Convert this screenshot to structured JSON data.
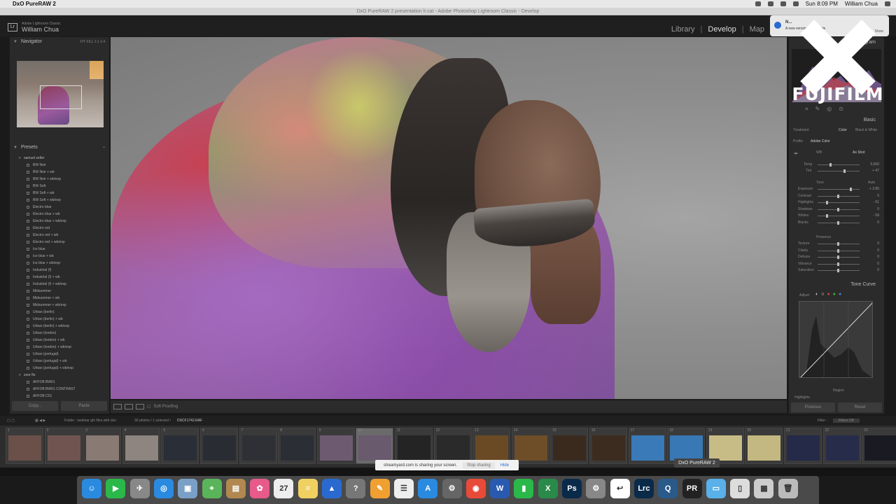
{
  "menubar": {
    "app": "DxO PureRAW 2",
    "time": "Sun 8:09 PM",
    "user": "William Chua"
  },
  "window_title": "DxO PureRAW 2 presentation lr.cat - Adobe Photoshop Lightroom Classic - Develop",
  "lr": {
    "catalog_label": "Adobe Lightroom Classic",
    "user": "William Chua",
    "modules": [
      "Library",
      "Develop",
      "Map"
    ],
    "active_module": "Develop"
  },
  "notification": {
    "title": "N...",
    "body": "A new version is available",
    "action": "Show"
  },
  "fuji_logo": "FUJIFILM",
  "left": {
    "navigator": "Navigator",
    "navigator_zoom": "FIT  FILL  1:1  1:4",
    "presets_title": "Presets",
    "presets": [
      {
        "label": "samuel zeller",
        "group": true
      },
      {
        "label": "BW Noir"
      },
      {
        "label": "BW Noir + wb"
      },
      {
        "label": "BW Noir + wb/exp"
      },
      {
        "label": "BW Soft"
      },
      {
        "label": "BW Soft + wb"
      },
      {
        "label": "BW Soft + wb/exp"
      },
      {
        "label": "Electro blue"
      },
      {
        "label": "Electro blue + wb"
      },
      {
        "label": "Electro blue + wb/exp"
      },
      {
        "label": "Electro red"
      },
      {
        "label": "Electro red + wb"
      },
      {
        "label": "Electro red + wb/exp"
      },
      {
        "label": "Ice blue"
      },
      {
        "label": "Ice blue + wb"
      },
      {
        "label": "Ice blue + wb/exp"
      },
      {
        "label": "Industrial (f)"
      },
      {
        "label": "Industrial (f) + wb"
      },
      {
        "label": "Industrial (f) + wb/exp"
      },
      {
        "label": "Midsummer"
      },
      {
        "label": "Midsummer + wb"
      },
      {
        "label": "Midsummer + wb/exp"
      },
      {
        "label": "Urban (berlin)"
      },
      {
        "label": "Urban (berlin) + wb"
      },
      {
        "label": "Urban (berlin) + wb/exp"
      },
      {
        "label": "Urban (london)"
      },
      {
        "label": "Urban (london) + wb"
      },
      {
        "label": "Urban (london) + wb/exp"
      },
      {
        "label": "Urban (portugal)"
      },
      {
        "label": "Urban (portugal) + wb"
      },
      {
        "label": "Urban (portugal) + wb/exp"
      },
      {
        "label": "zoor flo",
        "group": true
      },
      {
        "label": "AFFOB BW01"
      },
      {
        "label": "AFFOB BW01 CONTRAST"
      },
      {
        "label": "AFFOB C01"
      }
    ],
    "copy": "Copy...",
    "paste": "Paste"
  },
  "toolbar": {
    "soft_proofing": "Soft Proofing"
  },
  "right": {
    "histogram": "Histogram",
    "basic": "Basic",
    "treatment": "Treatment",
    "color": "Color",
    "bw": "Black & White",
    "profile": "Profile",
    "profile_value": "Adobe Color",
    "wb": "WB",
    "wb_value": "As Shot",
    "temp": "Temp",
    "temp_value": "5,000",
    "tint": "Tint",
    "tint_value": "+ 47",
    "tone": "Tone",
    "auto": "Auto",
    "sliders": [
      {
        "label": "Exposure",
        "value": "+ 2.85"
      },
      {
        "label": "Contrast",
        "value": "0"
      },
      {
        "label": "Highlights",
        "value": "- 61"
      },
      {
        "label": "Shadows",
        "value": "0"
      },
      {
        "label": "Whites",
        "value": "- 59"
      },
      {
        "label": "Blacks",
        "value": "0"
      }
    ],
    "presence": "Presence",
    "presence_sliders": [
      {
        "label": "Texture",
        "value": "0"
      },
      {
        "label": "Clarity",
        "value": "0"
      },
      {
        "label": "Dehaze",
        "value": "0"
      },
      {
        "label": "Vibrance",
        "value": "0"
      },
      {
        "label": "Saturation",
        "value": "0"
      }
    ],
    "tone_curve": "Tone Curve",
    "adjust": "Adjust",
    "region": "Region",
    "highlights": "Highlights",
    "previous": "Previous",
    "reset": "Reset"
  },
  "filmstrip_bar": {
    "folder": "Folder : webinar gfx files with dxo",
    "count": "30 photos / 1 selected /",
    "filename": "DSCF1742.RAF",
    "filter": "Filter :",
    "filter_value": "Filters Off"
  },
  "thumbs": [
    {
      "n": "1",
      "c": "#6a5048"
    },
    {
      "n": "2",
      "c": "#705450"
    },
    {
      "n": "3",
      "c": "#8a7a74"
    },
    {
      "n": "4",
      "c": "#8e8480"
    },
    {
      "n": "5",
      "c": "#2a2e36"
    },
    {
      "n": "6",
      "c": "#2a2c34"
    },
    {
      "n": "7",
      "c": "#2e3036"
    },
    {
      "n": "8",
      "c": "#2c2e36"
    },
    {
      "n": "9",
      "c": "#6e5a70"
    },
    {
      "n": "10",
      "c": "#6a5a6e"
    },
    {
      "n": "11",
      "c": "#242424"
    },
    {
      "n": "12",
      "c": "#2a2a2a"
    },
    {
      "n": "13",
      "c": "#6a4a24"
    },
    {
      "n": "14",
      "c": "#6e4e28"
    },
    {
      "n": "15",
      "c": "#3a2a1e"
    },
    {
      "n": "16",
      "c": "#3c2c20"
    },
    {
      "n": "17",
      "c": "#3a7ab8"
    },
    {
      "n": "18",
      "c": "#3878b4"
    },
    {
      "n": "19",
      "c": "#c8bc86"
    },
    {
      "n": "20",
      "c": "#c4b882"
    },
    {
      "n": "21",
      "c": "#242a48"
    },
    {
      "n": "22",
      "c": "#262c4a"
    },
    {
      "n": "23",
      "c": "#1a1a22"
    }
  ],
  "screen_share": {
    "text": "streamyard.com is sharing your screen.",
    "stop": "Stop sharing",
    "hide": "Hide"
  },
  "tooltip": "DxO PureRAW 2",
  "dock": [
    {
      "name": "finder",
      "c": "#2a8ae0",
      "g": "☺"
    },
    {
      "name": "facetime",
      "c": "#2ab84a",
      "g": "▶"
    },
    {
      "name": "launchpad",
      "c": "#888",
      "g": "✈"
    },
    {
      "name": "safari",
      "c": "#2a8ae0",
      "g": "◎"
    },
    {
      "name": "preview",
      "c": "#7aa0c8",
      "g": "▣"
    },
    {
      "name": "maps",
      "c": "#5ab45a",
      "g": "⌖"
    },
    {
      "name": "notebook",
      "c": "#b08850",
      "g": "▤"
    },
    {
      "name": "photos",
      "c": "#e85a8a",
      "g": "✿"
    },
    {
      "name": "calendar",
      "c": "#eee",
      "g": "27"
    },
    {
      "name": "notes",
      "c": "#f0d060",
      "g": "≡"
    },
    {
      "name": "keynote",
      "c": "#2a6ad0",
      "g": "▲"
    },
    {
      "name": "help",
      "c": "#777",
      "g": "?"
    },
    {
      "name": "pages",
      "c": "#f0a030",
      "g": "✎"
    },
    {
      "name": "reminders",
      "c": "#eee",
      "g": "☰"
    },
    {
      "name": "appstore",
      "c": "#2a8ae0",
      "g": "A"
    },
    {
      "name": "preferences",
      "c": "#666",
      "g": "⚙"
    },
    {
      "name": "chrome",
      "c": "#e84a3a",
      "g": "◉"
    },
    {
      "name": "word",
      "c": "#2a5ab0",
      "g": "W"
    },
    {
      "name": "numbers",
      "c": "#2ab84a",
      "g": "▮"
    },
    {
      "name": "excel",
      "c": "#2a8a4a",
      "g": "X"
    },
    {
      "name": "photoshop",
      "c": "#0a2a4a",
      "g": "Ps"
    },
    {
      "name": "automator",
      "c": "#888",
      "g": "⚙"
    },
    {
      "name": "back",
      "c": "#fff",
      "g": "↩"
    },
    {
      "name": "lightroom",
      "c": "#0a2a4a",
      "g": "Lrc"
    },
    {
      "name": "quicktime",
      "c": "#2a5a8a",
      "g": "Q"
    },
    {
      "name": "pureraw",
      "c": "#222",
      "g": "PR"
    },
    {
      "name": "folder",
      "c": "#5ab0e8",
      "g": "▭"
    },
    {
      "name": "document",
      "c": "#ddd",
      "g": "▯"
    },
    {
      "name": "screenshot",
      "c": "#ccc",
      "g": "▦"
    },
    {
      "name": "trash",
      "c": "#bbb",
      "g": "🗑"
    }
  ]
}
